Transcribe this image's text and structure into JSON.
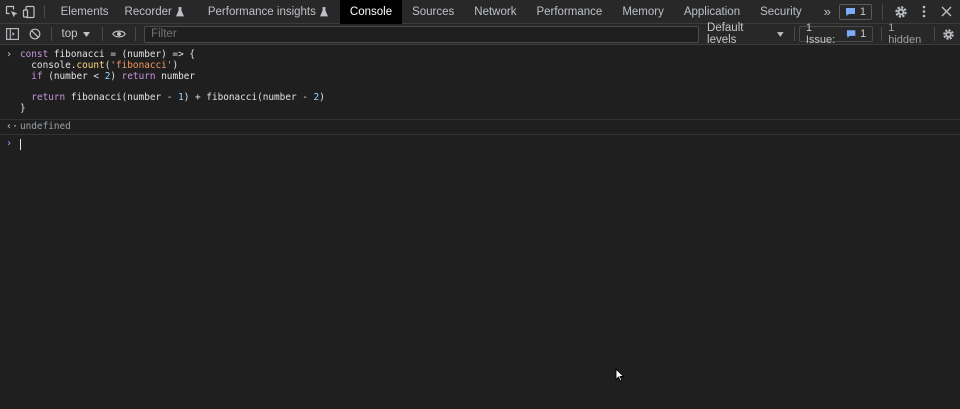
{
  "tabs": {
    "items": [
      {
        "label": "Elements",
        "active": false
      },
      {
        "label": "Recorder",
        "active": false,
        "experimental": true
      },
      {
        "label": "Performance insights",
        "active": false,
        "experimental": true
      },
      {
        "label": "Console",
        "active": true
      },
      {
        "label": "Sources",
        "active": false
      },
      {
        "label": "Network",
        "active": false
      },
      {
        "label": "Performance",
        "active": false
      },
      {
        "label": "Memory",
        "active": false
      },
      {
        "label": "Application",
        "active": false
      },
      {
        "label": "Security",
        "active": false
      }
    ],
    "more_glyph": "»",
    "issues_badge_count": "1"
  },
  "toolbar": {
    "context": "top",
    "filter_placeholder": "Filter",
    "levels": "Default levels",
    "issues_label": "1 Issue:",
    "issues_count": "1",
    "hidden": "1 hidden"
  },
  "console": {
    "code": [
      "const fibonacci = (number) => {",
      "  console.count('fibonacci')",
      "  if (number < 2) return number",
      "",
      "  return fibonacci(number - 1) + fibonacci(number - 2)",
      "}"
    ],
    "result": "undefined"
  },
  "colors": {
    "accent": "#7cacf8",
    "keyword": "#c695e0",
    "string": "#f29766",
    "number": "#9ad3ff",
    "method": "#ffd685"
  },
  "icons": {
    "inspect": "inspect-element-icon",
    "device": "device-toggle-icon",
    "sidebar": "sidebar-toggle-icon",
    "clear": "clear-console-icon",
    "eye": "live-expression-icon",
    "settings": "gear-icon",
    "kebab": "kebab-menu-icon",
    "close": "close-icon",
    "message": "message-icon"
  }
}
